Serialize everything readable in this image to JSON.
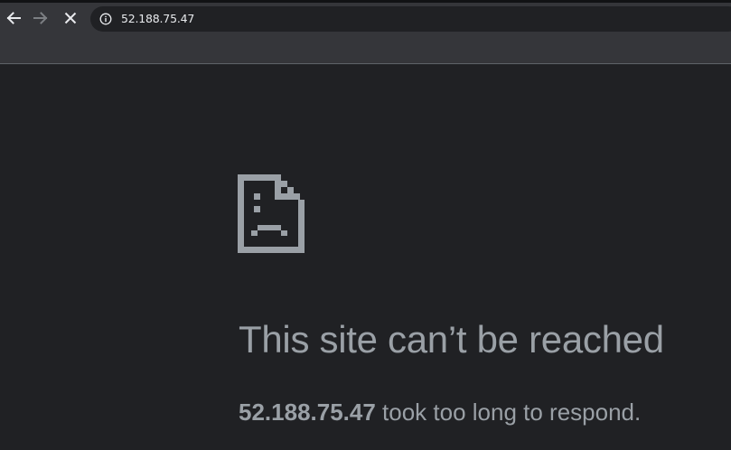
{
  "browser": {
    "address_bar": {
      "url": "52.188.75.47"
    },
    "icons": {
      "back": "arrow-left-icon",
      "forward": "arrow-right-icon",
      "stop": "close-icon",
      "site_info": "info-icon"
    }
  },
  "error_page": {
    "icon": "sad-page-icon",
    "title": "This site can’t be reached",
    "host": "52.188.75.47",
    "message": " took too long to respond."
  },
  "colors": {
    "page_background": "#202124",
    "toolbar_background": "#35363a",
    "text_muted": "#9aa0a6"
  }
}
